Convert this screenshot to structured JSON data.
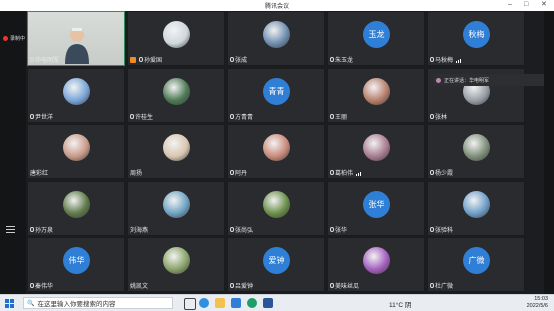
{
  "window": {
    "title": "腾讯会议"
  },
  "recording": {
    "label": "录制中"
  },
  "speaking": {
    "label": "正在讲话：华电明军"
  },
  "taskbar": {
    "search_placeholder": "在这里输入你要搜索的内容",
    "weather": "11°C 阴",
    "time": "15:03",
    "date": "2022/5/6"
  },
  "participants": [
    {
      "name": "华电明军",
      "kind": "video"
    },
    {
      "name": "孙爱国",
      "kind": "photo",
      "photo": "#cfd8dc",
      "icon": "orange"
    },
    {
      "name": "张成",
      "kind": "photo",
      "photo": "#6f8fb0"
    },
    {
      "name": "朱玉龙",
      "kind": "circle",
      "text": "玉龙",
      "color": "#2f7fd6"
    },
    {
      "name": "马秋梅",
      "kind": "circle",
      "text": "秋梅",
      "color": "#2f7fd6",
      "bars": true
    },
    {
      "name": "尹世洋",
      "kind": "photo",
      "photo": "#7aa6d9"
    },
    {
      "name": "许桂生",
      "kind": "photo",
      "photo": "#4e7a55"
    },
    {
      "name": "方青青",
      "kind": "circle",
      "text": "青青",
      "color": "#2f7fd6"
    },
    {
      "name": "王丽",
      "kind": "photo",
      "photo": "#b7806c"
    },
    {
      "name": "张林",
      "kind": "photo",
      "photo": "#9aa0a8"
    },
    {
      "name": "唐彩红",
      "kind": "photo",
      "photo": "#c99a8a",
      "nomic": true
    },
    {
      "name": "周扬",
      "kind": "photo",
      "photo": "#d9c6b0",
      "nomic": true
    },
    {
      "name": "阿丹",
      "kind": "photo",
      "photo": "#c98a7a"
    },
    {
      "name": "葛柏伟",
      "kind": "photo",
      "photo": "#a87c8f",
      "bars": true
    },
    {
      "name": "杨少霞",
      "kind": "photo",
      "photo": "#7f8f7a"
    },
    {
      "name": "孙万泉",
      "kind": "photo",
      "photo": "#5f7a4a"
    },
    {
      "name": "刘海燕",
      "kind": "photo",
      "photo": "#6fa3c2",
      "nomic": true
    },
    {
      "name": "张尚弘",
      "kind": "photo",
      "photo": "#6a8f4a"
    },
    {
      "name": "张华",
      "kind": "circle",
      "text": "张华",
      "color": "#2f7fd6"
    },
    {
      "name": "张验科",
      "kind": "photo",
      "photo": "#6f9ec9"
    },
    {
      "name": "秦伟华",
      "kind": "circle",
      "text": "伟华",
      "color": "#2f7fd6"
    },
    {
      "name": "姚凯文",
      "kind": "photo",
      "photo": "#8aa36a",
      "nomic": true
    },
    {
      "name": "吕爱钟",
      "kind": "circle",
      "text": "爱钟",
      "color": "#2f7fd6"
    },
    {
      "name": "美味丝瓜",
      "kind": "photo",
      "photo": "#a45fbf"
    },
    {
      "name": "杜广微",
      "kind": "circle",
      "text": "广微",
      "color": "#2f7fd6"
    }
  ]
}
